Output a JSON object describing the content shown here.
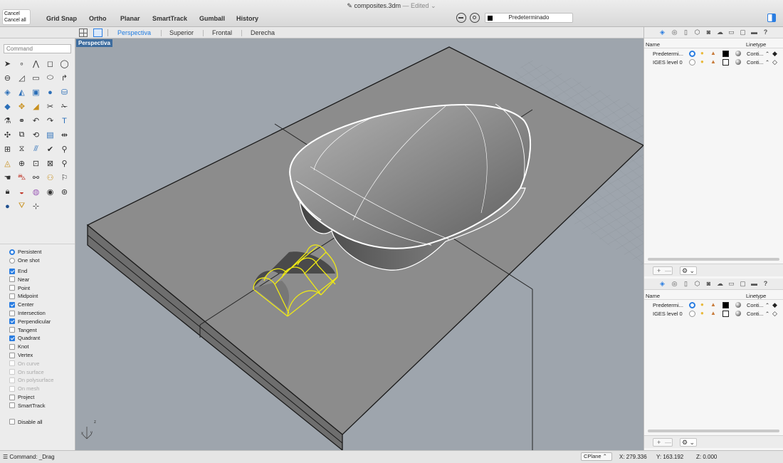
{
  "title_bar": {
    "cancel_label": "Cancel",
    "cancel_all_label": "Cancel all",
    "document_name": "composites.3dm",
    "document_status": "— Edited ⌄",
    "buttons": [
      "Grid Snap",
      "Ortho",
      "Planar",
      "SmartTrack",
      "Gumball",
      "History"
    ],
    "layer_dropdown": "Predeterminado"
  },
  "view_tabs": {
    "tabs": [
      "Perspectiva",
      "Superior",
      "Frontal",
      "Derecha"
    ],
    "active": "Perspectiva"
  },
  "left_panel": {
    "command_placeholder": "Command",
    "osnap_mode": [
      {
        "label": "Persistent",
        "selected": true
      },
      {
        "label": "One shot",
        "selected": false
      }
    ],
    "osnaps": [
      {
        "label": "End",
        "checked": true,
        "enabled": true
      },
      {
        "label": "Near",
        "checked": false,
        "enabled": true
      },
      {
        "label": "Point",
        "checked": false,
        "enabled": true
      },
      {
        "label": "Midpoint",
        "checked": false,
        "enabled": true
      },
      {
        "label": "Center",
        "checked": true,
        "enabled": true
      },
      {
        "label": "Intersection",
        "checked": false,
        "enabled": true
      },
      {
        "label": "Perpendicular",
        "checked": true,
        "enabled": true
      },
      {
        "label": "Tangent",
        "checked": false,
        "enabled": true
      },
      {
        "label": "Quadrant",
        "checked": true,
        "enabled": true
      },
      {
        "label": "Knot",
        "checked": false,
        "enabled": true
      },
      {
        "label": "Vertex",
        "checked": false,
        "enabled": true
      },
      {
        "label": "On curve",
        "checked": false,
        "enabled": false
      },
      {
        "label": "On surface",
        "checked": false,
        "enabled": false
      },
      {
        "label": "On polysurface",
        "checked": false,
        "enabled": false
      },
      {
        "label": "On mesh",
        "checked": false,
        "enabled": false
      },
      {
        "label": "Project",
        "checked": false,
        "enabled": true
      },
      {
        "label": "SmartTrack",
        "checked": false,
        "enabled": true
      }
    ],
    "disable_all": "Disable all"
  },
  "viewport": {
    "label": "Perspectiva",
    "axes": [
      "x",
      "y",
      "z"
    ]
  },
  "layers_panel": {
    "col_name": "Name",
    "col_linetype": "Linetype",
    "rows": [
      {
        "name": "Predetermi...",
        "current": true,
        "color": "#000000",
        "linetype": "Conti... ⌃"
      },
      {
        "name": "IGES level 0",
        "current": false,
        "color": "#ffffff",
        "linetype": "Conti... ⌃"
      }
    ],
    "add": "+",
    "remove": "—",
    "gear": "⚙ ⌄"
  },
  "status_bar": {
    "command": "Command: _Drag",
    "cplane": "CPlane ⌃",
    "x": "X: 279.336",
    "y": "Y: 163.192",
    "z": "Z: 0.000"
  },
  "colors": {
    "accent": "#2a7de1",
    "selection": "#e8e020",
    "viewport_bg": "#9ea5ad"
  }
}
